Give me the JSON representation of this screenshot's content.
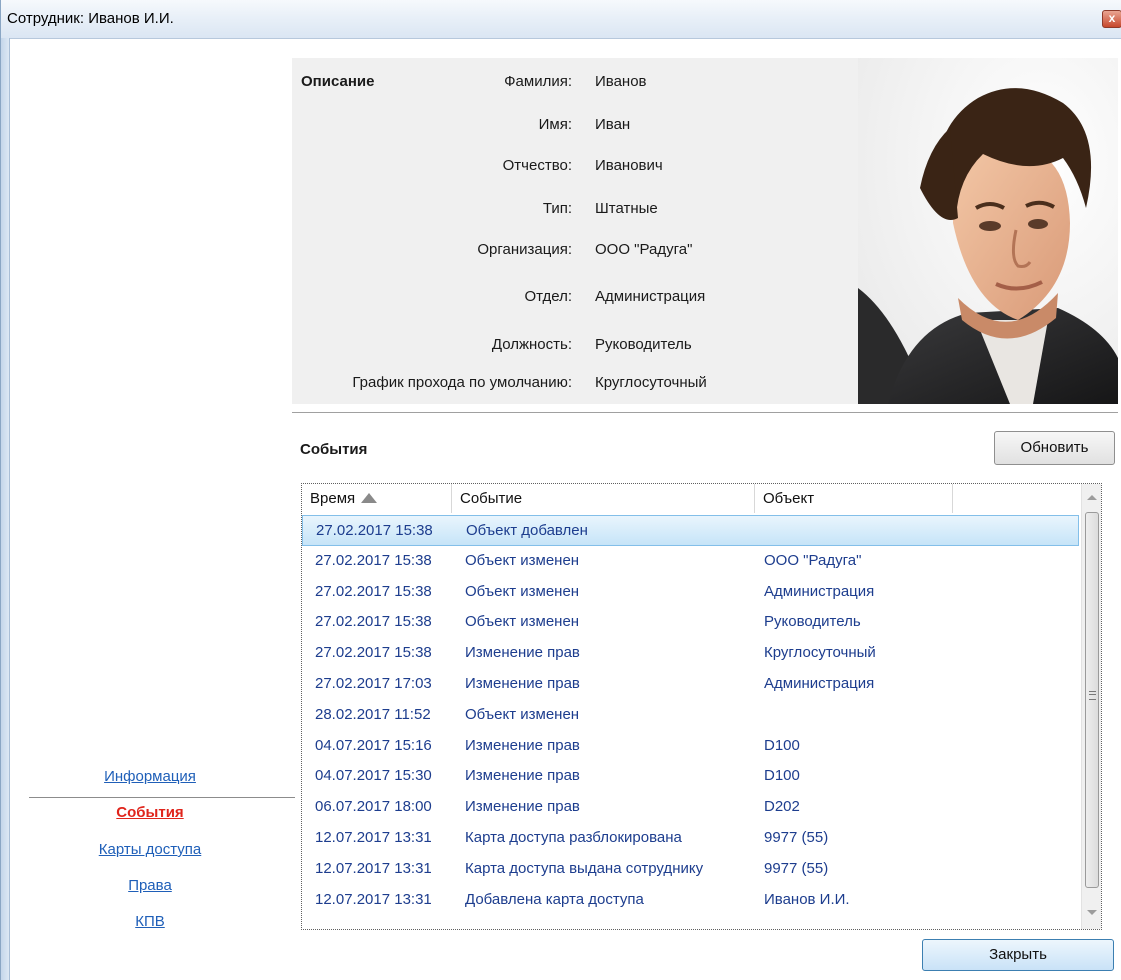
{
  "window": {
    "title": "Сотрудник: Иванов И.И.",
    "close_glyph": "x"
  },
  "nav": {
    "items": [
      {
        "label": "Информация",
        "active": false
      },
      {
        "label": "События",
        "active": true
      },
      {
        "label": "Карты доступа",
        "active": false
      },
      {
        "label": "Права",
        "active": false
      },
      {
        "label": "КПВ",
        "active": false
      }
    ]
  },
  "description": {
    "title": "Описание",
    "fields": [
      {
        "label": "Фамилия:",
        "value": "Иванов"
      },
      {
        "label": "Имя:",
        "value": "Иван"
      },
      {
        "label": "Отчество:",
        "value": "Иванович"
      },
      {
        "label": "Тип:",
        "value": "Штатные"
      },
      {
        "label": "Организация:",
        "value": "ООО \"Радуга\""
      },
      {
        "label": "Отдел:",
        "value": "Администрация"
      },
      {
        "label": "Должность:",
        "value": "Руководитель"
      },
      {
        "label": "График прохода по умолчанию:",
        "value": "Круглосуточный"
      }
    ]
  },
  "events": {
    "title": "События",
    "refresh_label": "Обновить",
    "columns": {
      "time": "Время",
      "event": "Событие",
      "object": "Объект"
    },
    "sort_icon": "sort-ascending-icon",
    "rows": [
      {
        "time": "27.02.2017 15:38",
        "event": "Объект добавлен",
        "object": "",
        "selected": true
      },
      {
        "time": "27.02.2017 15:38",
        "event": "Объект изменен",
        "object": "ООО \"Радуга\""
      },
      {
        "time": "27.02.2017 15:38",
        "event": "Объект изменен",
        "object": "Администрация"
      },
      {
        "time": "27.02.2017 15:38",
        "event": "Объект изменен",
        "object": "Руководитель"
      },
      {
        "time": "27.02.2017 15:38",
        "event": "Изменение прав",
        "object": "Круглосуточный"
      },
      {
        "time": "27.02.2017 17:03",
        "event": "Изменение прав",
        "object": "Администрация"
      },
      {
        "time": "28.02.2017 11:52",
        "event": "Объект изменен",
        "object": ""
      },
      {
        "time": "04.07.2017 15:16",
        "event": "Изменение прав",
        "object": "D100"
      },
      {
        "time": "04.07.2017 15:30",
        "event": "Изменение прав",
        "object": "D100"
      },
      {
        "time": "06.07.2017 18:00",
        "event": "Изменение прав",
        "object": "D202"
      },
      {
        "time": "12.07.2017 13:31",
        "event": "Карта доступа разблокирована",
        "object": "9977 (55)"
      },
      {
        "time": "12.07.2017 13:31",
        "event": "Карта доступа выдана сотруднику",
        "object": "9977 (55)"
      },
      {
        "time": "12.07.2017 13:31",
        "event": "Добавлена карта доступа",
        "object": "Иванов И.И."
      }
    ]
  },
  "footer": {
    "close_label": "Закрыть"
  },
  "colors": {
    "accent": "#1f5fb8",
    "active_nav": "#e0241b",
    "row_text": "#1d3d8e",
    "selection": "#c6e4f8"
  }
}
